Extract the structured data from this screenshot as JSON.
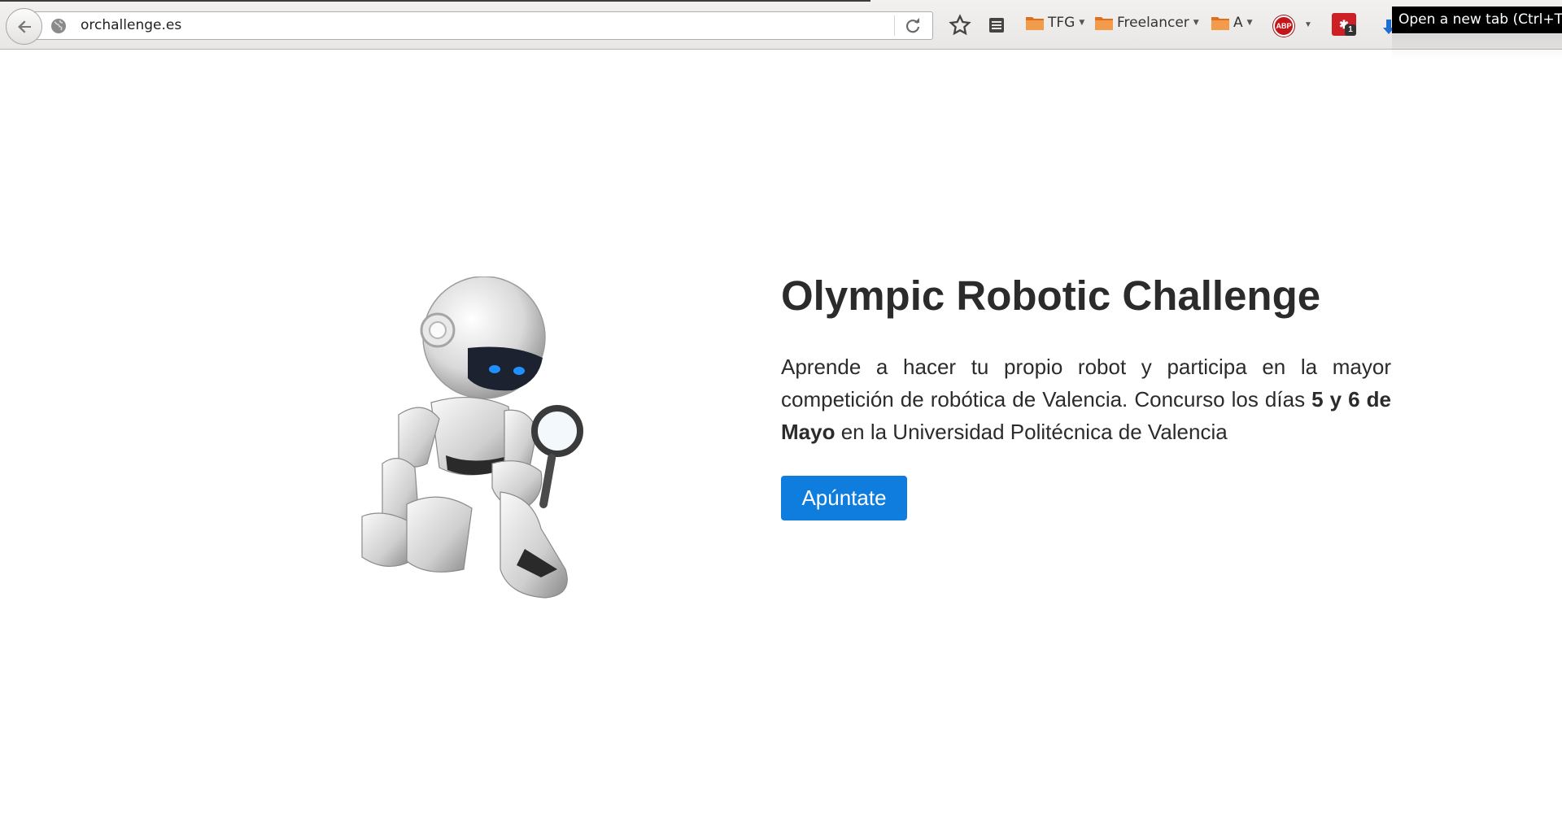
{
  "browser": {
    "url": "orchallenge.es",
    "bookmarks": [
      {
        "label": "TFG"
      },
      {
        "label": "Freelancer"
      },
      {
        "label": "A"
      }
    ],
    "adblock_label": "ABP",
    "extension_badge_count": "1",
    "tooltip": "Open a new tab (Ctrl+T)",
    "icons": [
      "back-arrow-icon",
      "globe-icon",
      "reload-icon",
      "star-icon",
      "reading-list-icon",
      "folder-icon",
      "adblock-icon",
      "puzzle-extension-icon",
      "download-icon"
    ]
  },
  "hero": {
    "title": "Olympic Robotic Challenge",
    "desc_part1": "Aprende a hacer tu propio robot y participa en la mayor competición de robótica de Valencia. Concurso los días ",
    "desc_bold": "5 y 6 de Mayo",
    "desc_part2": " en la Universidad Politécnica de Valencia",
    "cta_label": "Apúntate",
    "image": "robot-with-magnifying-glass"
  },
  "colors": {
    "cta_bg": "#0f7ddd",
    "text": "#2b2b2b",
    "robot_eyes": "#1e90ff"
  }
}
